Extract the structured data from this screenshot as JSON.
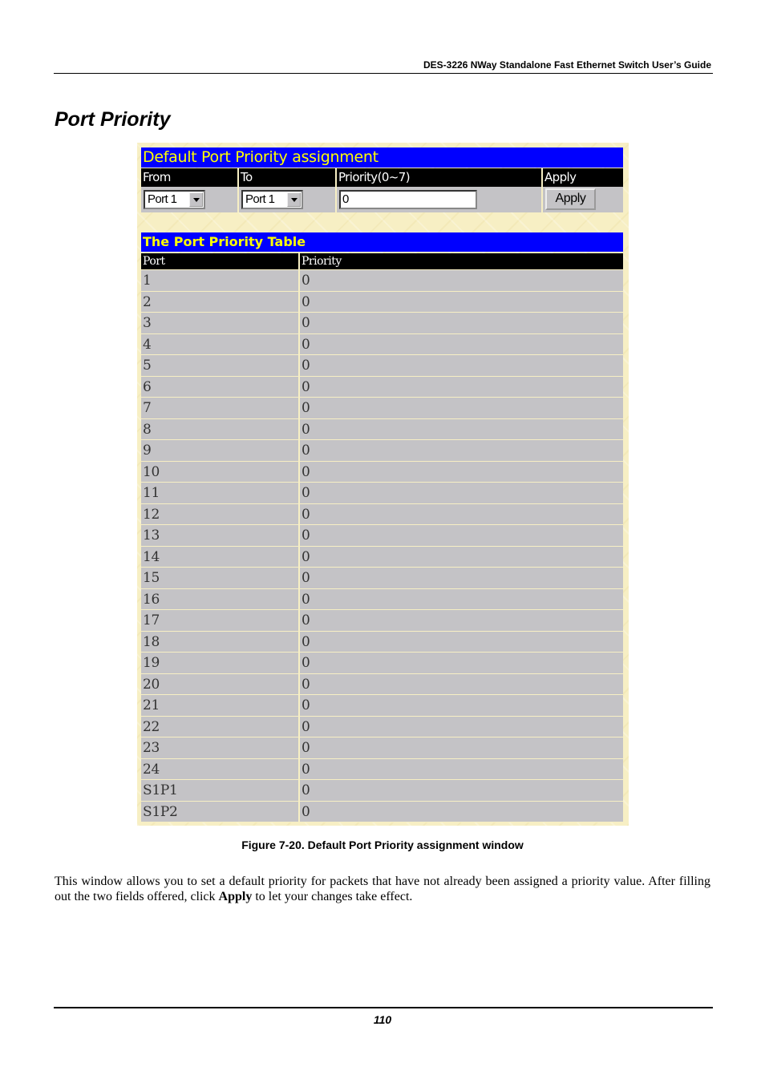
{
  "running_header": "DES-3226 NWay Standalone Fast Ethernet Switch User’s Guide",
  "section_title": "Port Priority",
  "figure": {
    "assignment": {
      "title": "Default Port Priority assignment",
      "headers": {
        "from": "From",
        "to": "To",
        "priority": "Priority(0~7)",
        "apply": "Apply"
      },
      "from_value": "Port 1",
      "to_value": "Port 1",
      "priority_value": "0",
      "apply_button": "Apply"
    },
    "table": {
      "title": "The Port Priority Table",
      "headers": {
        "port": "Port",
        "priority": "Priority"
      },
      "rows": [
        {
          "port": "1",
          "priority": "0"
        },
        {
          "port": "2",
          "priority": "0"
        },
        {
          "port": "3",
          "priority": "0"
        },
        {
          "port": "4",
          "priority": "0"
        },
        {
          "port": "5",
          "priority": "0"
        },
        {
          "port": "6",
          "priority": "0"
        },
        {
          "port": "7",
          "priority": "0"
        },
        {
          "port": "8",
          "priority": "0"
        },
        {
          "port": "9",
          "priority": "0"
        },
        {
          "port": "10",
          "priority": "0"
        },
        {
          "port": "11",
          "priority": "0"
        },
        {
          "port": "12",
          "priority": "0"
        },
        {
          "port": "13",
          "priority": "0"
        },
        {
          "port": "14",
          "priority": "0"
        },
        {
          "port": "15",
          "priority": "0"
        },
        {
          "port": "16",
          "priority": "0"
        },
        {
          "port": "17",
          "priority": "0"
        },
        {
          "port": "18",
          "priority": "0"
        },
        {
          "port": "19",
          "priority": "0"
        },
        {
          "port": "20",
          "priority": "0"
        },
        {
          "port": "21",
          "priority": "0"
        },
        {
          "port": "22",
          "priority": "0"
        },
        {
          "port": "23",
          "priority": "0"
        },
        {
          "port": "24",
          "priority": "0"
        },
        {
          "port": "S1P1",
          "priority": "0"
        },
        {
          "port": "S1P2",
          "priority": "0"
        }
      ]
    },
    "caption": "Figure 7-20.  Default Port Priority assignment window"
  },
  "body": {
    "text_before": "This window allows you to set a default priority for packets that have not already been assigned a priority value. After filling out the two fields offered, click ",
    "bold": "Apply",
    "text_after": " to let your changes take effect."
  },
  "page_number": "110"
}
